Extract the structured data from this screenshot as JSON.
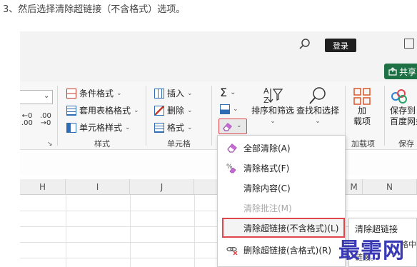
{
  "caption": "3、然后选择清除超链接（不含格式）选项。",
  "titlebar": {
    "login_label": "登录"
  },
  "share": {
    "label": "共享"
  },
  "ribbon": {
    "styles_group": {
      "items": [
        "条件格式",
        "套用表格格式",
        "单元格样式"
      ],
      "label": "样式"
    },
    "cells_group": {
      "items": [
        "插入",
        "删除",
        "格式"
      ],
      "label": "单元格"
    },
    "editing": {
      "sum_symbol": "Σ",
      "sort_label": "排序和筛选",
      "find_label": "查找和选择"
    },
    "addins": {
      "label_line1": "加",
      "label_line2": "载项",
      "group_label": "加载项"
    },
    "save": {
      "label_line1": "保存到",
      "label_line2": "百度网盘",
      "group_label": "保存"
    }
  },
  "columns": [
    "H",
    "I",
    "J",
    "M",
    "N"
  ],
  "clear_menu": {
    "items": [
      {
        "label": "全部清除(A)",
        "icon": "eraser-icon",
        "disabled": false
      },
      {
        "label": "清除格式(F)",
        "icon": "clear-format-icon",
        "disabled": false
      },
      {
        "label": "清除内容(C)",
        "icon": "",
        "disabled": false
      },
      {
        "label": "清除批注(M)",
        "icon": "",
        "disabled": true
      },
      {
        "label": "清除超链接(不含格式)(L)",
        "icon": "",
        "disabled": false,
        "highlighted": true
      },
      {
        "label": "删除超链接(含格式)(R)",
        "icon": "remove-link-icon",
        "disabled": false
      }
    ]
  },
  "tooltip": {
    "title": "清除超链接",
    "line1": "格中",
    "line2": "链接。"
  },
  "watermark": "最需网",
  "colors": {
    "share_green": "#1e7145",
    "highlight_red": "#e0474c",
    "watermark_blue": "#3a3ab5"
  }
}
